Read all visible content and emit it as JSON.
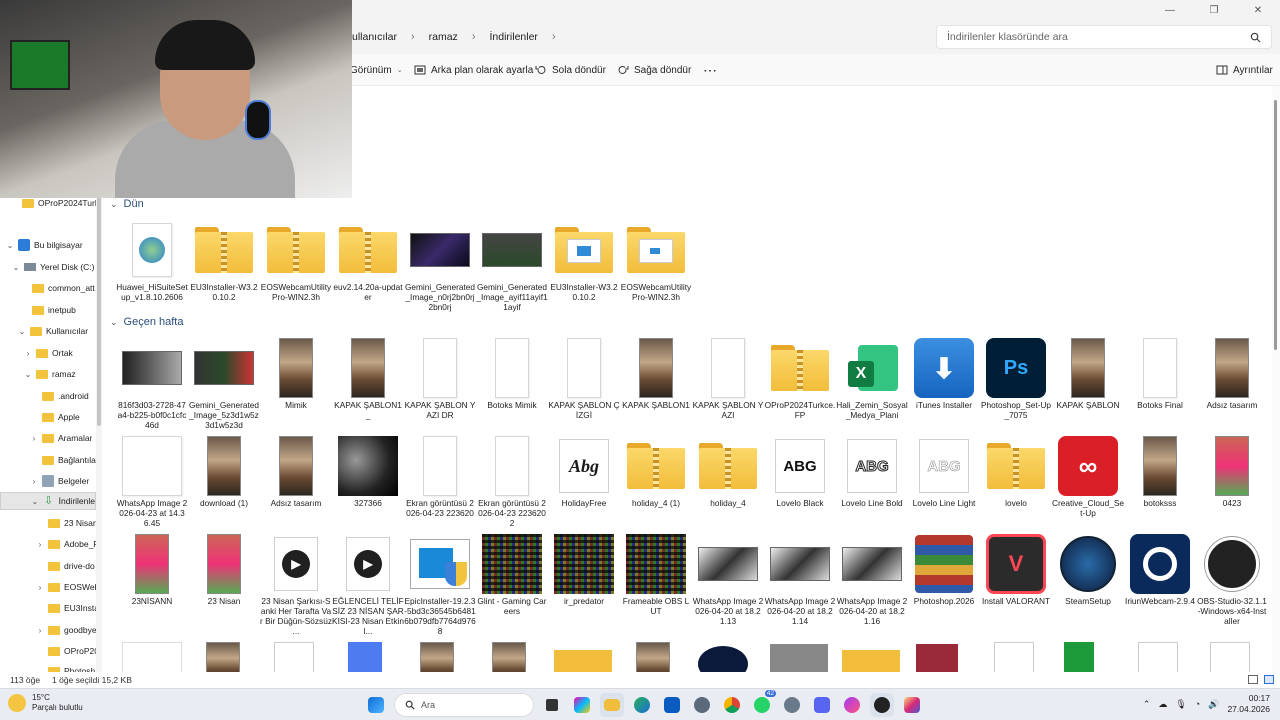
{
  "window": {
    "breadcrumb": [
      "ullanıcılar",
      "ramaz",
      "İndirilenler"
    ],
    "search_placeholder": "İndirilenler klasöründe ara"
  },
  "toolbar": {
    "view_label": "Görünüm",
    "wallpaper_label": "Arka plan olarak ayarla",
    "rotate_left_label": "Sola döndür",
    "rotate_right_label": "Sağa döndür",
    "more_label": "⋯",
    "details_label": "Ayrıntılar"
  },
  "sidebar": {
    "items": [
      {
        "label": "OProP2024Turkc",
        "icon": "folder-icon"
      },
      {
        "label": "Bu bilgisayar",
        "icon": "computer-icon"
      },
      {
        "label": "Yerel Disk (C:)",
        "icon": "drive-icon"
      },
      {
        "label": "common_att",
        "icon": "folder-icon"
      },
      {
        "label": "inetpub",
        "icon": "folder-icon"
      },
      {
        "label": "Kullanıcılar",
        "icon": "folder-icon"
      },
      {
        "label": "Ortak",
        "icon": "folder-icon"
      },
      {
        "label": "ramaz",
        "icon": "folder-icon"
      },
      {
        "label": ".android",
        "icon": "folder-icon"
      },
      {
        "label": "Apple",
        "icon": "folder-icon"
      },
      {
        "label": "Aramalar",
        "icon": "search-folder-icon"
      },
      {
        "label": "Bağlantıla",
        "icon": "links-folder-icon"
      },
      {
        "label": "Belgeler",
        "icon": "documents-icon"
      },
      {
        "label": "İndirilenle",
        "icon": "downloads-icon"
      },
      {
        "label": "23 Nisan",
        "icon": "folder-icon"
      },
      {
        "label": "Adobe_F",
        "icon": "folder-icon"
      },
      {
        "label": "drive-do",
        "icon": "folder-icon"
      },
      {
        "label": "EOSWeb",
        "icon": "folder-icon"
      },
      {
        "label": "EU3Insta",
        "icon": "folder-icon"
      },
      {
        "label": "goodbye",
        "icon": "folder-icon"
      },
      {
        "label": "OProP20",
        "icon": "folder-icon"
      },
      {
        "label": "Photosh",
        "icon": "folder-icon"
      }
    ]
  },
  "groups": {
    "yesterday": "Dün",
    "last_week": "Geçen hafta"
  },
  "files": {
    "yesterday": [
      "Huawei_HiSuiteSetup_v1.8.10.2606",
      "EU3Installer-W3.20.10.2",
      "EOSWebcamUtilityPro-WIN2.3h",
      "euv2.14.20a-updater",
      "Gemini_Generated_Image_n0rj2bn0rj2bn0rj",
      "Gemini_Generated_Image_ayif11ayif11ayif",
      "EU3Installer-W3.20.10.2",
      "EOSWebcamUtilityPro-WIN2.3h"
    ],
    "row1": [
      "816f3d03-2728-47a4-b225-b0f0c1cfc46d",
      "Gemini_Generated_Image_5z3d1w5z3d1w5z3d",
      "Mimik",
      "KAPAK ŞABLON1_",
      "KAPAK ŞABLON YAZI DR",
      "Botoks Mimik",
      "KAPAK ŞABLON ÇİZGİ",
      "KAPAK ŞABLON1",
      "KAPAK ŞABLON YAZI",
      "OProP2024Turkce.FP",
      "Hali_Zemin_Sosyal_Medya_Plani",
      "iTunes Installer",
      "Photoshop_Set-Up_7075",
      "KAPAK ŞABLON",
      "Botoks Final",
      "Adsız tasarım"
    ],
    "row2": [
      "WhatsApp Image 2026-04-23 at 14.36.45",
      "download (1)",
      "Adsız tasarım",
      "327366",
      "Ekran görüntüsü 2026-04-23 223620",
      "Ekran görüntüsü 2026-04-23 2236202",
      "HolidayFree",
      "holiday_4 (1)",
      "holiday_4",
      "Lovelo Black",
      "Lovelo Line Bold",
      "Lovelo Line Light",
      "lovelo",
      "Creative_Cloud_Set-Up",
      "botoksss",
      "0423"
    ],
    "row3": [
      "23NİSANN",
      "23 Nisan",
      "23 Nisan Şarkısı-Sanki Her Tarafta Var Bir Düğün-Sözsüz ...",
      "EĞLENCELİ TELİFSİZ 23 NİSAN ŞARKISI-23 Nisan Etkinl...",
      "EpicInstaller-19.2.3-5bd3c36545b64816b079dfb7764d9768",
      "Glint - Gaming Careers",
      "ir_predator",
      "Frameable OBS LUT",
      "WhatsApp Image 2026-04-20 at 18.21.13",
      "WhatsApp Image 2026-04-20 at 18.21.14",
      "WhatsApp Image 2026-04-20 at 18.21.16",
      "Photoshop.2026",
      "Install VALORANT",
      "SteamSetup",
      "IriunWebcam-2.9.4",
      "OBS-Studio-32.1.1-Windows-x64-Installer"
    ]
  },
  "icon_text": {
    "font_black": "ABG",
    "font_bold": "ABG",
    "font_light": "ABG",
    "ps": "Ps",
    "signature": "Abg"
  },
  "status": {
    "count": "113 öğe",
    "selected": "1 öğe seçildi  15,2 KB"
  },
  "taskbar": {
    "temperature": "15°C",
    "weather": "Parçalı bulutlu",
    "search_label": "Ara",
    "badge_count": "42",
    "time": "00:17",
    "date": "27.04.2026"
  },
  "colors": {
    "folder": "#f2bd3a",
    "selection": "#e6e6e6",
    "accent": "#0067c0"
  }
}
